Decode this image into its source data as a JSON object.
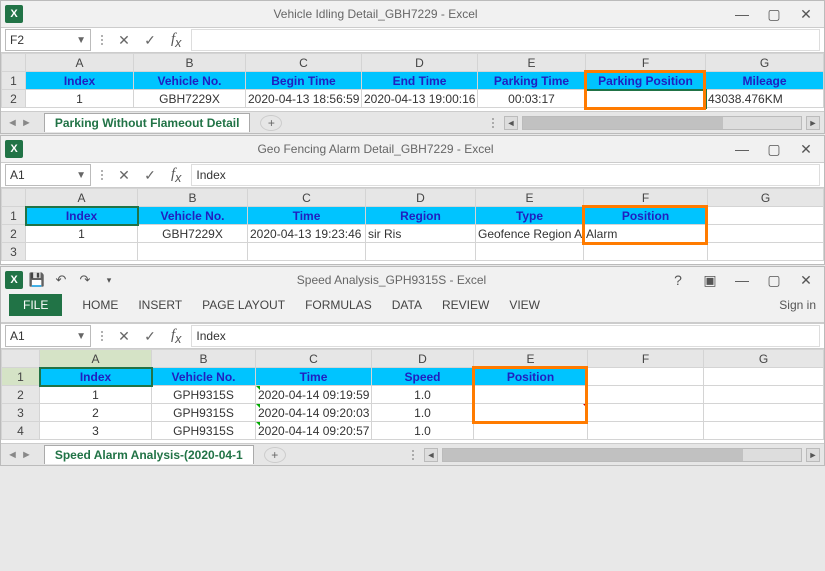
{
  "win1": {
    "title": "Vehicle Idling Detail_GBH7229 - Excel",
    "name_box": "F2",
    "formula": "",
    "col_letters": [
      "A",
      "B",
      "C",
      "D",
      "E",
      "F",
      "G"
    ],
    "headers": [
      "Index",
      "Vehicle No.",
      "Begin Time",
      "End Time",
      "Parking Time",
      "Parking Position",
      "Mileage"
    ],
    "row": [
      "1",
      "GBH7229X",
      "2020-04-13 18:56:59",
      "2020-04-13 19:00:16",
      "00:03:17",
      "",
      "43038.476KM"
    ],
    "sheet_tab": "Parking Without Flameout Detail"
  },
  "win2": {
    "title": "Geo Fencing Alarm Detail_GBH7229 - Excel",
    "name_box": "A1",
    "formula": "Index",
    "col_letters": [
      "A",
      "B",
      "C",
      "D",
      "E",
      "F",
      "G"
    ],
    "headers": [
      "Index",
      "Vehicle No.",
      "Time",
      "Region",
      "Type",
      "Position",
      ""
    ],
    "row": [
      "1",
      "GBH7229X",
      "2020-04-13 19:23:46",
      "sir Ris",
      "Geofence Region Alarm",
      "Alarm",
      ""
    ]
  },
  "win3": {
    "title": "Speed Analysis_GPH9315S - Excel",
    "name_box": "A1",
    "formula": "Index",
    "menu": {
      "file": "FILE",
      "home": "HOME",
      "insert": "INSERT",
      "page_layout": "PAGE LAYOUT",
      "formulas": "FORMULAS",
      "data": "DATA",
      "review": "REVIEW",
      "view": "VIEW"
    },
    "signin": "Sign in",
    "col_letters": [
      "A",
      "B",
      "C",
      "D",
      "E",
      "F",
      "G"
    ],
    "headers": [
      "Index",
      "Vehicle No.",
      "Time",
      "Speed",
      "Position",
      "",
      ""
    ],
    "rows": [
      [
        "1",
        "GPH9315S",
        "2020-04-14 09:19:59",
        "1.0",
        "",
        "",
        ""
      ],
      [
        "2",
        "GPH9315S",
        "2020-04-14 09:20:03",
        "1.0",
        "",
        "",
        ""
      ],
      [
        "3",
        "GPH9315S",
        "2020-04-14 09:20:57",
        "1.0",
        "",
        "",
        ""
      ]
    ],
    "sheet_tab": "Speed Alarm Analysis-(2020-04-1"
  }
}
